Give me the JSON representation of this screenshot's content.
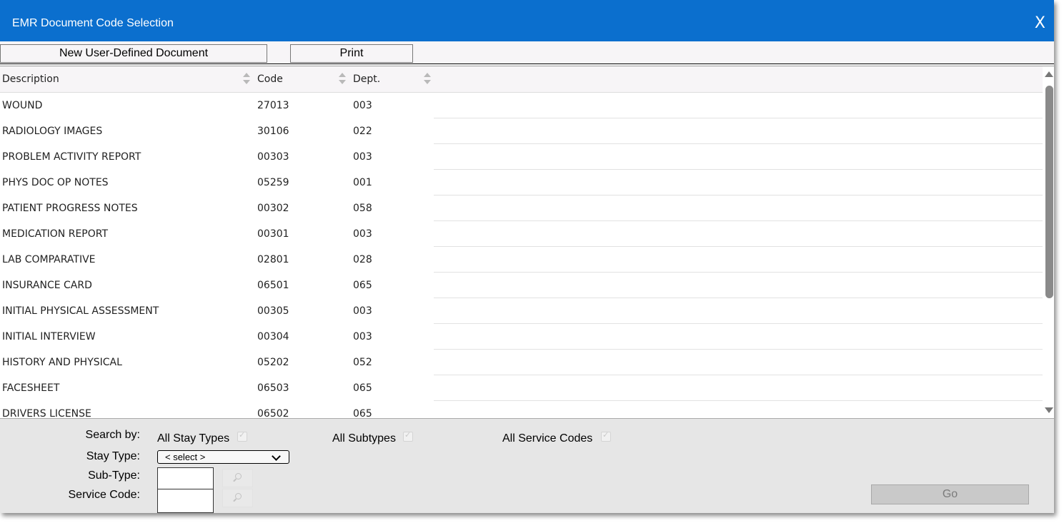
{
  "dialog": {
    "title": "EMR Document Code Selection",
    "close_label": "X"
  },
  "toolbar": {
    "new_doc_label": "New User-Defined Document",
    "print_label": "Print"
  },
  "grid": {
    "columns": [
      "Description",
      "Code",
      "Dept."
    ],
    "rows": [
      {
        "description": "WOUND",
        "code": "27013",
        "dept": "003"
      },
      {
        "description": "RADIOLOGY IMAGES",
        "code": "30106",
        "dept": "022"
      },
      {
        "description": "PROBLEM ACTIVITY REPORT",
        "code": "00303",
        "dept": "003"
      },
      {
        "description": "PHYS DOC OP NOTES",
        "code": "05259",
        "dept": "001"
      },
      {
        "description": "PATIENT PROGRESS NOTES",
        "code": "00302",
        "dept": "058"
      },
      {
        "description": "MEDICATION REPORT",
        "code": "00301",
        "dept": "003"
      },
      {
        "description": "LAB COMPARATIVE",
        "code": "02801",
        "dept": "028"
      },
      {
        "description": "INSURANCE CARD",
        "code": "06501",
        "dept": "065"
      },
      {
        "description": "INITIAL PHYSICAL ASSESSMENT",
        "code": "00305",
        "dept": "003"
      },
      {
        "description": "INITIAL INTERVIEW",
        "code": "00304",
        "dept": "003"
      },
      {
        "description": "HISTORY AND PHYSICAL",
        "code": "05202",
        "dept": "052"
      },
      {
        "description": "FACESHEET",
        "code": "06503",
        "dept": "065"
      },
      {
        "description": "DRIVERS LICENSE",
        "code": "06502",
        "dept": "065"
      }
    ]
  },
  "search": {
    "search_by_label": "Search by:",
    "all_stay_types_label": "All Stay Types",
    "all_subtypes_label": "All Subtypes",
    "all_service_codes_label": "All Service Codes",
    "stay_type_label": "Stay Type:",
    "stay_type_value": "< select >",
    "sub_type_label": "Sub-Type:",
    "service_code_label": "Service Code:",
    "go_label": "Go"
  },
  "icons": [
    "close-icon",
    "sort-icon",
    "chevron-down-icon",
    "search-icon",
    "checkbox-checked-icon"
  ]
}
